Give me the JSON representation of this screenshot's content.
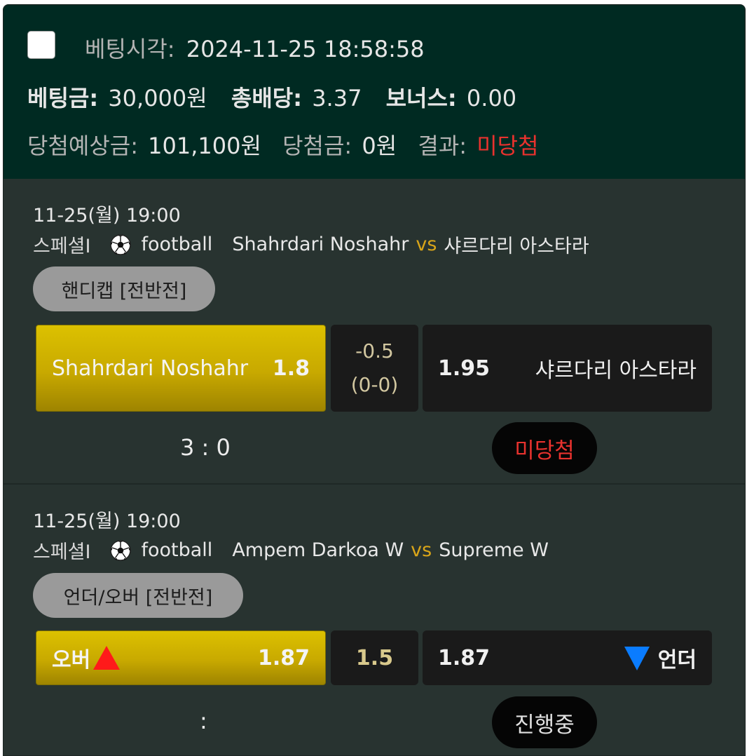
{
  "summary": {
    "bet_time_label": "베팅시각:",
    "bet_time": "2024-11-25 18:58:58",
    "bet_amount_label": "베팅금:",
    "bet_amount": "30,000원",
    "total_odds_label": "총배당:",
    "total_odds": "3.37",
    "bonus_label": "보너스:",
    "bonus": "0.00",
    "expected_win_label": "당첨예상금:",
    "expected_win": "101,100원",
    "win_amount_label": "당첨금:",
    "win_amount": "0원",
    "result_label": "결과:",
    "result": "미당첨"
  },
  "games": [
    {
      "datetime": "11-25(월) 19:00",
      "category": "스페셜I",
      "sport": "football",
      "home": "Shahrdari Noshahr",
      "vs": "vs",
      "away": "샤르다리 아스타라",
      "market": "핸디캡 [전반전]",
      "home_pick": "Shahrdari Noshahr",
      "home_odds": "1.8",
      "line_top": "-0.5",
      "line_bottom": "(0-0)",
      "away_odds": "1.95",
      "away_pick": "샤르다리 아스타라",
      "score": "3 : 0",
      "status": "미당첨",
      "status_color": "#e8322e"
    },
    {
      "datetime": "11-25(월) 19:00",
      "category": "스페셜I",
      "sport": "football",
      "home": "Ampem Darkoa W",
      "vs": "vs",
      "away": "Supreme W",
      "market": "언더/오버 [전반전]",
      "home_pick": "오버",
      "home_odds": "1.87",
      "line": "1.5",
      "away_odds": "1.87",
      "away_pick": "언더",
      "score": ":",
      "status": "진행중",
      "status_color": "#e0e0e0"
    }
  ],
  "icons": {
    "checkbox": "checkbox-icon",
    "sport": "soccer-ball-icon",
    "over": "triangle-up-icon",
    "under": "triangle-down-icon"
  },
  "colors": {
    "header_bg": "#002a22",
    "body_bg": "#283330",
    "gold": "#c8a900",
    "loss_red": "#e8322e",
    "vs_gold": "#d9a519",
    "over_red": "#ff1a1a",
    "under_blue": "#0a7cff"
  }
}
